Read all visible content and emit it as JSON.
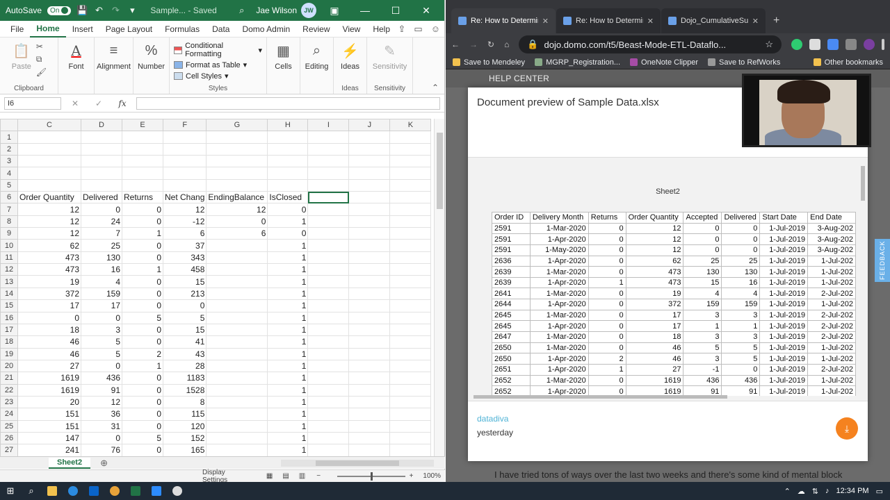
{
  "excel": {
    "autosave_label": "AutoSave",
    "autosave_state": "On",
    "doc_title": "Sample... - Saved",
    "user_name": "Jae Wilson",
    "user_initials": "JW",
    "tabs": [
      "File",
      "Home",
      "Insert",
      "Page Layout",
      "Formulas",
      "Data",
      "Domo Admin",
      "Review",
      "View",
      "Help"
    ],
    "active_tab": "Home",
    "ribbon": {
      "paste": "Paste",
      "clipboard": "Clipboard",
      "font": "Font",
      "alignment": "Alignment",
      "number": "Number",
      "conditional_formatting": "Conditional Formatting",
      "format_as_table": "Format as Table",
      "cell_styles": "Cell Styles",
      "styles": "Styles",
      "cells": "Cells",
      "editing": "Editing",
      "ideas": "Ideas",
      "ideas_group": "Ideas",
      "sensitivity": "Sensitivity",
      "sensitivity_group": "Sensitivity"
    },
    "name_box": "I6",
    "fx_label": "fx",
    "formula_value": "",
    "columns": [
      "C",
      "D",
      "E",
      "F",
      "G",
      "H",
      "I",
      "J",
      "K"
    ],
    "rows": [
      {
        "n": "1",
        "cells": [
          "",
          "",
          "",
          "",
          "",
          "",
          "",
          "",
          ""
        ]
      },
      {
        "n": "2",
        "cells": [
          "",
          "",
          "",
          "",
          "",
          "",
          "",
          "",
          ""
        ]
      },
      {
        "n": "3",
        "cells": [
          "",
          "",
          "",
          "",
          "",
          "",
          "",
          "",
          ""
        ]
      },
      {
        "n": "4",
        "cells": [
          "",
          "",
          "",
          "",
          "",
          "",
          "",
          "",
          ""
        ]
      },
      {
        "n": "5",
        "cells": [
          "",
          "",
          "",
          "",
          "",
          "",
          "",
          "",
          ""
        ]
      },
      {
        "n": "6",
        "cells": [
          "Order Quantity",
          "Delivered",
          "Returns",
          "Net Chang",
          "EndingBalance",
          "IsClosed",
          "",
          "",
          ""
        ]
      },
      {
        "n": "7",
        "cells": [
          "12",
          "0",
          "0",
          "12",
          "12",
          "0",
          "",
          "",
          ""
        ]
      },
      {
        "n": "8",
        "cells": [
          "12",
          "24",
          "0",
          "-12",
          "0",
          "1",
          "",
          "",
          ""
        ]
      },
      {
        "n": "9",
        "cells": [
          "12",
          "7",
          "1",
          "6",
          "6",
          "0",
          "",
          "",
          ""
        ]
      },
      {
        "n": "10",
        "cells": [
          "62",
          "25",
          "0",
          "37",
          "",
          "1",
          "",
          "",
          ""
        ]
      },
      {
        "n": "11",
        "cells": [
          "473",
          "130",
          "0",
          "343",
          "",
          "1",
          "",
          "",
          ""
        ]
      },
      {
        "n": "12",
        "cells": [
          "473",
          "16",
          "1",
          "458",
          "",
          "1",
          "",
          "",
          ""
        ]
      },
      {
        "n": "13",
        "cells": [
          "19",
          "4",
          "0",
          "15",
          "",
          "1",
          "",
          "",
          ""
        ]
      },
      {
        "n": "14",
        "cells": [
          "372",
          "159",
          "0",
          "213",
          "",
          "1",
          "",
          "",
          ""
        ]
      },
      {
        "n": "15",
        "cells": [
          "17",
          "17",
          "0",
          "0",
          "",
          "1",
          "",
          "",
          ""
        ]
      },
      {
        "n": "16",
        "cells": [
          "0",
          "0",
          "5",
          "5",
          "",
          "1",
          "",
          "",
          ""
        ]
      },
      {
        "n": "17",
        "cells": [
          "18",
          "3",
          "0",
          "15",
          "",
          "1",
          "",
          "",
          ""
        ]
      },
      {
        "n": "18",
        "cells": [
          "46",
          "5",
          "0",
          "41",
          "",
          "1",
          "",
          "",
          ""
        ]
      },
      {
        "n": "19",
        "cells": [
          "46",
          "5",
          "2",
          "43",
          "",
          "1",
          "",
          "",
          ""
        ]
      },
      {
        "n": "20",
        "cells": [
          "27",
          "0",
          "1",
          "28",
          "",
          "1",
          "",
          "",
          ""
        ]
      },
      {
        "n": "21",
        "cells": [
          "1619",
          "436",
          "0",
          "1183",
          "",
          "1",
          "",
          "",
          ""
        ]
      },
      {
        "n": "22",
        "cells": [
          "1619",
          "91",
          "0",
          "1528",
          "",
          "1",
          "",
          "",
          ""
        ]
      },
      {
        "n": "23",
        "cells": [
          "20",
          "12",
          "0",
          "8",
          "",
          "1",
          "",
          "",
          ""
        ]
      },
      {
        "n": "24",
        "cells": [
          "151",
          "36",
          "0",
          "115",
          "",
          "1",
          "",
          "",
          ""
        ]
      },
      {
        "n": "25",
        "cells": [
          "151",
          "31",
          "0",
          "120",
          "",
          "1",
          "",
          "",
          ""
        ]
      },
      {
        "n": "26",
        "cells": [
          "147",
          "0",
          "5",
          "152",
          "",
          "1",
          "",
          "",
          ""
        ]
      },
      {
        "n": "27",
        "cells": [
          "241",
          "76",
          "0",
          "165",
          "",
          "1",
          "",
          "",
          ""
        ]
      }
    ],
    "sheet_tab": "Sheet2",
    "display_settings": "Display Settings",
    "zoom": "100%"
  },
  "browser": {
    "tabs": [
      {
        "title": "Re: How to Determin",
        "active": true
      },
      {
        "title": "Re: How to Determin",
        "active": false
      },
      {
        "title": "Dojo_CumulativeSum",
        "active": false
      }
    ],
    "url": "dojo.domo.com/t5/Beast-Mode-ETL-Dataflo...",
    "bookmarks": [
      "Save to Mendeley",
      "MGRP_Registration...",
      "OneNote Clipper",
      "Save to RefWorks"
    ],
    "other_bookmarks": "Other bookmarks",
    "help_center": "HELP CENTER",
    "modal_title": "Document preview of Sample Data.xlsx",
    "sheet_name": "Sheet2",
    "preview_headers": [
      "Order ID",
      "Delivery Month",
      "Returns",
      "Order Quantity",
      "Accepted",
      "Delivered",
      "Start Date",
      "End Date"
    ],
    "preview_rows": [
      [
        "2591",
        "1-Mar-2020",
        "0",
        "12",
        "0",
        "0",
        "1-Jul-2019",
        "3-Aug-202"
      ],
      [
        "2591",
        "1-Apr-2020",
        "0",
        "12",
        "0",
        "0",
        "1-Jul-2019",
        "3-Aug-202"
      ],
      [
        "2591",
        "1-May-2020",
        "0",
        "12",
        "0",
        "0",
        "1-Jul-2019",
        "3-Aug-202"
      ],
      [
        "2636",
        "1-Apr-2020",
        "0",
        "62",
        "25",
        "25",
        "1-Jul-2019",
        "1-Jul-202"
      ],
      [
        "2639",
        "1-Mar-2020",
        "0",
        "473",
        "130",
        "130",
        "1-Jul-2019",
        "1-Jul-202"
      ],
      [
        "2639",
        "1-Apr-2020",
        "1",
        "473",
        "15",
        "16",
        "1-Jul-2019",
        "1-Jul-202"
      ],
      [
        "2641",
        "1-Mar-2020",
        "0",
        "19",
        "4",
        "4",
        "1-Jul-2019",
        "2-Jul-202"
      ],
      [
        "2644",
        "1-Apr-2020",
        "0",
        "372",
        "159",
        "159",
        "1-Jul-2019",
        "1-Jul-202"
      ],
      [
        "2645",
        "1-Mar-2020",
        "0",
        "17",
        "3",
        "3",
        "1-Jul-2019",
        "2-Jul-202"
      ],
      [
        "2645",
        "1-Apr-2020",
        "0",
        "17",
        "1",
        "1",
        "1-Jul-2019",
        "2-Jul-202"
      ],
      [
        "2647",
        "1-Mar-2020",
        "0",
        "18",
        "3",
        "3",
        "1-Jul-2019",
        "2-Jul-202"
      ],
      [
        "2650",
        "1-Mar-2020",
        "0",
        "46",
        "5",
        "5",
        "1-Jul-2019",
        "1-Jul-202"
      ],
      [
        "2650",
        "1-Apr-2020",
        "2",
        "46",
        "3",
        "5",
        "1-Jul-2019",
        "1-Jul-202"
      ],
      [
        "2651",
        "1-Apr-2020",
        "1",
        "27",
        "-1",
        "0",
        "1-Jul-2019",
        "2-Jul-202"
      ],
      [
        "2652",
        "1-Mar-2020",
        "0",
        "1619",
        "436",
        "436",
        "1-Jul-2019",
        "1-Jul-202"
      ],
      [
        "2652",
        "1-Apr-2020",
        "0",
        "1619",
        "91",
        "91",
        "1-Jul-2019",
        "1-Jul-202"
      ]
    ],
    "author": "datadiva",
    "posted": "yesterday",
    "feedback": "FEEDBACK",
    "post_text": "I have tried tons of ways over the last two weeks and there's some kind of mental block"
  },
  "taskbar": {
    "time": "12:34 PM"
  },
  "colors": {
    "excel_green": "#217346",
    "domo_orange": "#f5821f",
    "chrome_dark": "#35363a"
  }
}
